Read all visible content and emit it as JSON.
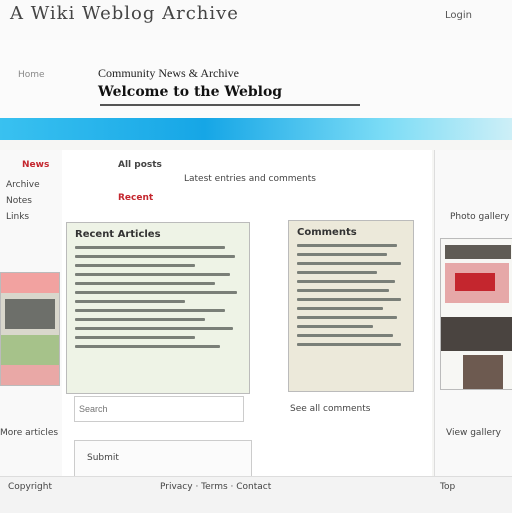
{
  "header": {
    "site_title": "A Wiki Weblog Archive",
    "top_link": "Login",
    "left_tag": "Home",
    "heading_line1": "Community News & Archive",
    "heading_line2": "Welcome to the Weblog"
  },
  "sidebar": {
    "left_label": "News",
    "left_items": [
      "Archive",
      "Notes",
      "Links"
    ]
  },
  "main": {
    "intro_label": "All posts",
    "intro_sub": "Recent",
    "filter_text": "Latest entries and comments",
    "panel_a_title": "Recent Articles",
    "panel_b_title": "Comments",
    "input_placeholder": "Search",
    "submit_label": "Submit",
    "caption_left": "More articles",
    "caption_mid": "See all comments"
  },
  "right_sidebar": {
    "label": "Photo gallery",
    "caption": "View gallery"
  },
  "footer": {
    "left": "Copyright",
    "mid": "Privacy · Terms · Contact",
    "right": "Top"
  },
  "colors": {
    "accent": "#16a6e6",
    "heading_red": "#c4262e"
  },
  "icons": [
    "logo-icon",
    "search-icon"
  ]
}
